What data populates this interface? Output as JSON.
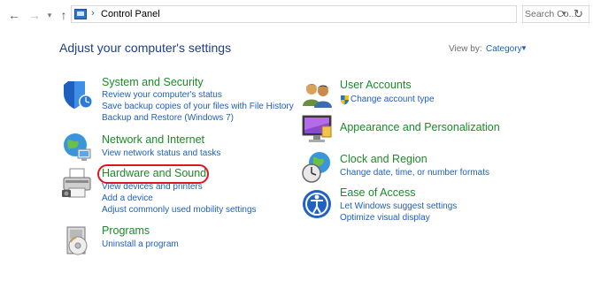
{
  "address_bar": {
    "path": "Control Panel",
    "search_placeholder": "Search Co..."
  },
  "header": {
    "title": "Adjust your computer's settings",
    "view_by_label": "View by:",
    "view_by_value": "Category"
  },
  "left_categories": [
    {
      "title": "System and Security",
      "icon": "shield-icon",
      "links": [
        "Review your computer's status",
        "Save backup copies of your files with File History",
        "Backup and Restore (Windows 7)"
      ]
    },
    {
      "title": "Network and Internet",
      "icon": "network-globe-icon",
      "links": [
        "View network status and tasks"
      ]
    },
    {
      "title": "Hardware and Sound",
      "icon": "printer-icon",
      "highlighted": true,
      "links": [
        "View devices and printers",
        "Add a device",
        "Adjust commonly used mobility settings"
      ]
    },
    {
      "title": "Programs",
      "icon": "programs-disc-icon",
      "links": [
        "Uninstall a program"
      ]
    }
  ],
  "right_categories": [
    {
      "title": "User Accounts",
      "icon": "users-icon",
      "links": [
        "Change account type"
      ]
    },
    {
      "title": "Appearance and Personalization",
      "icon": "monitor-icon",
      "links": []
    },
    {
      "title": "Clock and Region",
      "icon": "clock-globe-icon",
      "links": [
        "Change date, time, or number formats"
      ]
    },
    {
      "title": "Ease of Access",
      "icon": "ease-of-access-icon",
      "links": [
        "Let Windows suggest settings",
        "Optimize visual display"
      ]
    }
  ],
  "colors": {
    "title_green": "#1b8a29",
    "link_blue": "#1e5fbf",
    "heading_blue": "#1e3f8a",
    "highlight_red": "#e0161f"
  }
}
